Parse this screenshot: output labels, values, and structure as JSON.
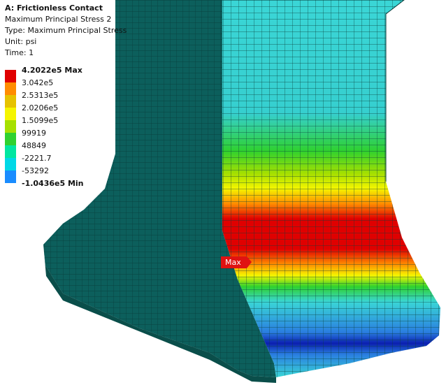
{
  "info": {
    "title": "A: Frictionless Contact",
    "result_name": "Maximum Principal Stress 2",
    "type_line": "Type: Maximum Principal Stress",
    "unit_line": "Unit: psi",
    "time_line": "Time: 1"
  },
  "legend": {
    "entries": [
      {
        "label": "4.2022e5 Max",
        "color": "#e00000",
        "bold": true
      },
      {
        "label": "3.042e5",
        "color": "#ff8c00",
        "bold": false
      },
      {
        "label": "2.5313e5",
        "color": "#e6c200",
        "bold": false
      },
      {
        "label": "2.0206e5",
        "color": "#f5f500",
        "bold": false
      },
      {
        "label": "1.5099e5",
        "color": "#a6e000",
        "bold": false
      },
      {
        "label": "99919",
        "color": "#2fd12f",
        "bold": false
      },
      {
        "label": "48849",
        "color": "#00e6a0",
        "bold": false
      },
      {
        "label": "-2221.7",
        "color": "#00d8e6",
        "bold": false
      },
      {
        "label": "-53292",
        "color": "#1a8cff",
        "bold": false
      },
      {
        "label": "-1.0436e5 Min",
        "color": "#0000cc",
        "bold": true
      }
    ]
  },
  "probe": {
    "label": "Max",
    "color": "#e01212"
  },
  "colors": {
    "base": "#0c5f5c",
    "base_dark": "#0a4e4a",
    "cyan": "#3ad6d6",
    "mesh_line": "#083a38",
    "blue_band": "#2a7fe0",
    "blue_core": "#0b1fb0"
  }
}
